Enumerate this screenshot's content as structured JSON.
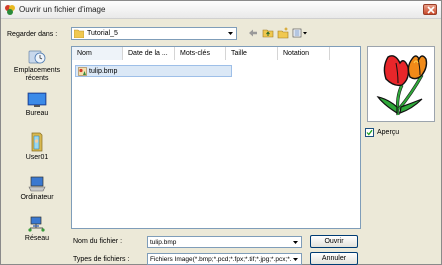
{
  "window": {
    "title": "Ouvrir un fichier d'image"
  },
  "lookin": {
    "label": "Regarder dans :",
    "value": "Tutorial_5"
  },
  "toolbar": {
    "back_icon": "back-arrow-icon",
    "up_icon": "folder-up-icon",
    "newfolder_icon": "new-folder-icon",
    "views_icon": "view-menu-icon"
  },
  "places": [
    {
      "label": "Emplacements récents",
      "icon": "recent-places-icon"
    },
    {
      "label": "Bureau",
      "icon": "desktop-icon"
    },
    {
      "label": "User01",
      "icon": "user-folder-icon"
    },
    {
      "label": "Ordinateur",
      "icon": "computer-icon"
    },
    {
      "label": "Réseau",
      "icon": "network-icon"
    }
  ],
  "filelist": {
    "columns": [
      "Nom",
      "Date de la ...",
      "Mots-clés",
      "Taille",
      "Notation"
    ],
    "files": [
      {
        "name": "tulip.bmp",
        "icon": "bmp-file-icon"
      }
    ]
  },
  "preview": {
    "checkbox_label": "Aperçu",
    "checked": true
  },
  "filename": {
    "label": "Nom du fichier :",
    "value": "tulip.bmp"
  },
  "filetype": {
    "label": "Types de fichiers :",
    "value": "Fichiers Image(*.bmp;*.pcd;*.fpx;*.tif;*.jpg;*.pcx;*.j"
  },
  "buttons": {
    "open": "Ouvrir",
    "cancel": "Annuler"
  },
  "colors": {
    "selection": "#dbe8f6",
    "border": "#7f9db9",
    "dialog_bg": "#ece9d8"
  }
}
